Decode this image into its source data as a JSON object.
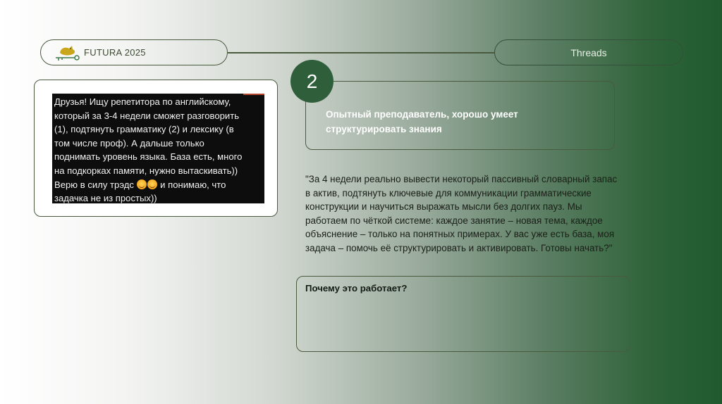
{
  "header": {
    "brand_name": "FUTURA 2025",
    "threads_label": "Threads"
  },
  "post": {
    "text_before_emoji": "Друзья! Ищу репетитора по английскому,\nкоторый за 3-4 недели сможет разговорить\n(1), подтянуть грамматику (2) и лексику (в\nтом числе проф). А дальше только\nподнимать уровень языка. База есть, много\nна подкорках памяти, нужно вытаскивать))\nВерю в силу трэдс ",
    "text_after_emoji": " и понимаю, что\nзадачка не из простых))"
  },
  "step": {
    "number": "2",
    "feature_text": "Опытный преподаватель, хорошо умеет структурировать знания"
  },
  "reply": {
    "text": "\"За 4 недели реально вывести некоторый пассивный словарный запас в актив, подтянуть ключевые для коммуникации грамматические конструкции и научиться выражать мысли без долгих пауз. Мы работаем по чёткой системе: каждое занятие – новая тема, каждое объяснение – только на понятных примерах. У вас уже есть база, моя задача – помочь её структурировать и активировать. Готовы начать?\""
  },
  "why": {
    "title": "Почему это работает?"
  },
  "colors": {
    "accent_green": "#2e5f3a",
    "border": "#4a5a3e",
    "logo_yellow": "#c9a61c"
  },
  "icons": {
    "logo": "bird-key-logo-icon",
    "emoji": "smiling-face-emoji-icon"
  }
}
